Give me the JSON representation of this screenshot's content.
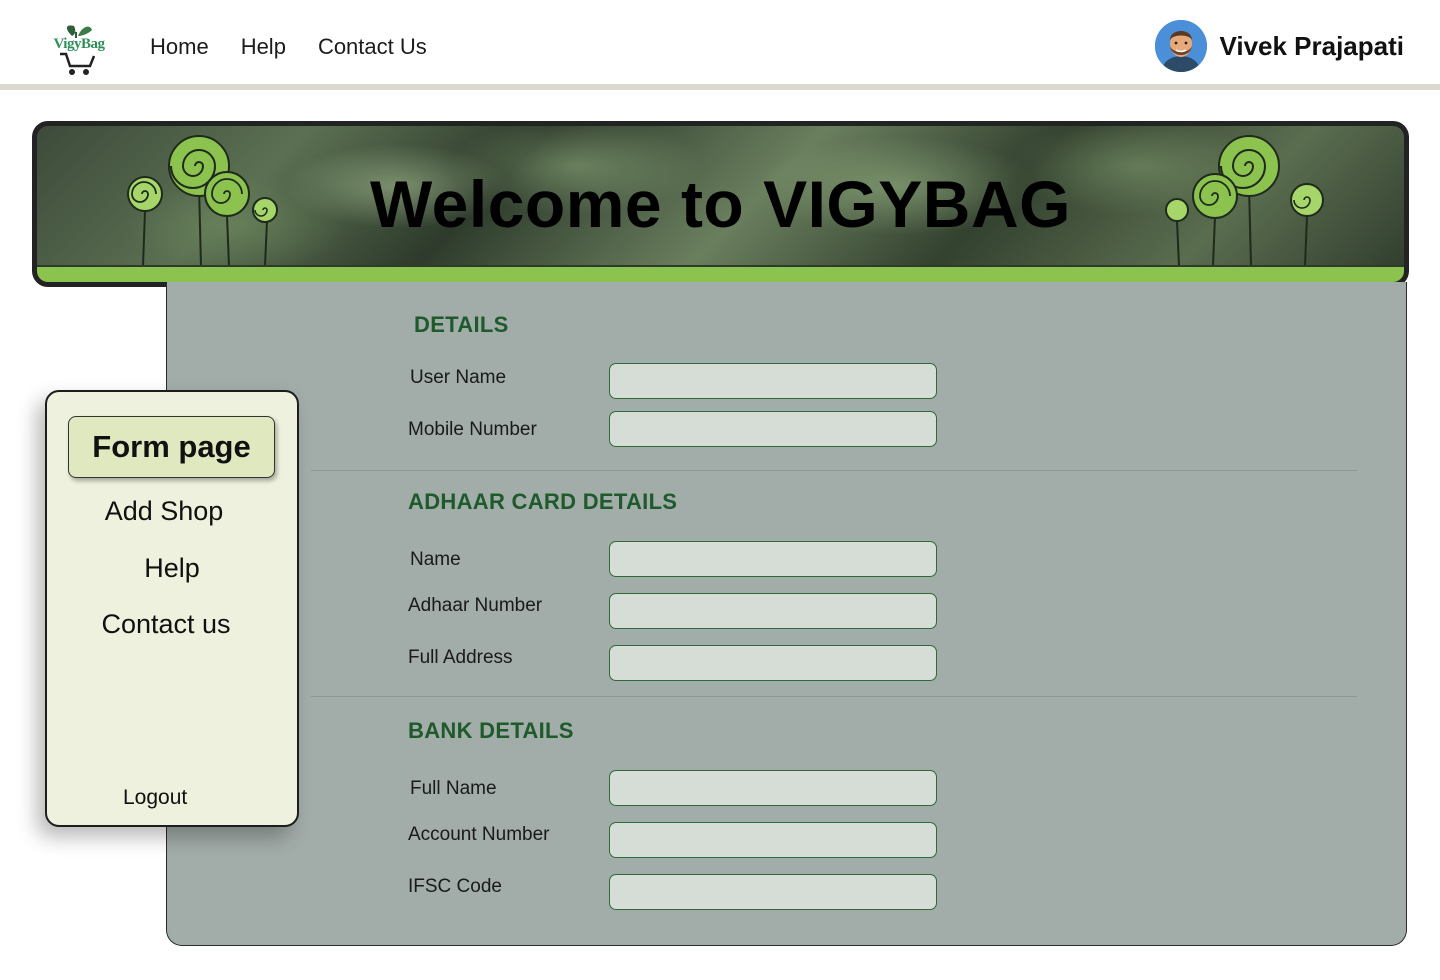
{
  "brand": {
    "logo_text": "VigyBag"
  },
  "nav": {
    "links": [
      "Home",
      "Help",
      "Contact Us"
    ]
  },
  "user": {
    "name": "Vivek Prajapati"
  },
  "banner": {
    "title": "Welcome to VIGYBAG"
  },
  "sidebar": {
    "active_item": "Form page",
    "items": [
      "Add Shop",
      "Help",
      "Contact us"
    ],
    "logout": "Logout"
  },
  "form": {
    "details": {
      "title": "DETAILS",
      "fields": [
        {
          "label": "User Name",
          "value": ""
        },
        {
          "label": "Mobile Number",
          "value": ""
        }
      ]
    },
    "adhaar": {
      "title": "ADHAAR CARD DETAILS",
      "fields": [
        {
          "label": "Name",
          "value": ""
        },
        {
          "label": "Adhaar Number",
          "value": ""
        },
        {
          "label": "Full Address",
          "value": ""
        }
      ]
    },
    "bank": {
      "title": "BANK DETAILS",
      "fields": [
        {
          "label": "Full Name",
          "value": ""
        },
        {
          "label": "Account Number",
          "value": ""
        },
        {
          "label": "IFSC Code",
          "value": ""
        }
      ]
    }
  },
  "colors": {
    "accent_green": "#1e5a2b",
    "panel": "#a2aca8",
    "sidebar": "#eef1dd",
    "ground": "#8cc34f"
  }
}
